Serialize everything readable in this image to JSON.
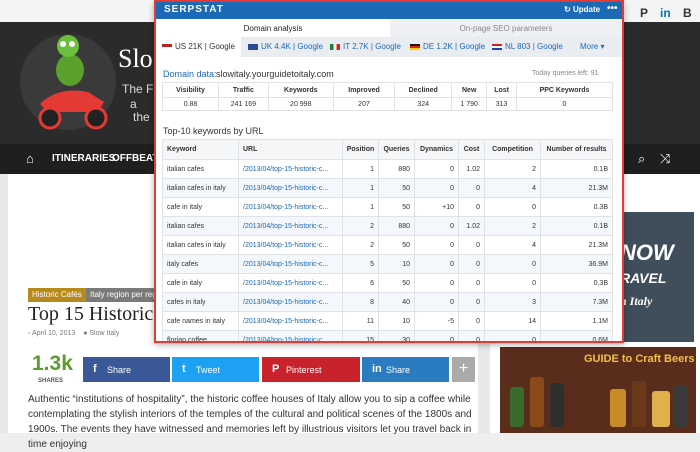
{
  "site": {
    "title": "Slo",
    "tagline_lines": [
      "The Fi",
      "a",
      "the"
    ],
    "social": [
      "P",
      "in",
      "B"
    ],
    "nav": [
      "ITINERARIES",
      "OFFBEAT &"
    ],
    "tags": [
      "Historic Cafés",
      "Italy region per reg"
    ],
    "post_title": "Top 15 Historic",
    "post_date": "April 10, 2013",
    "post_author": "Slow Italy",
    "share_count": "1.3k",
    "share_label": "SHARES",
    "share_buttons": [
      {
        "label": "Share",
        "icon": "f",
        "color": "#3b5998"
      },
      {
        "label": "Tweet",
        "icon": "t",
        "color": "#1da1f2"
      },
      {
        "label": "Pinterest",
        "icon": "P",
        "color": "#c8232c"
      },
      {
        "label": "Share",
        "icon": "in",
        "color": "#2a7bbf"
      }
    ],
    "share_more": "+",
    "body": "Authentic “institutions of hospitality”, the historic coffee houses of Italy allow you to sip a coffee while contemplating the stylish interiors of the temples of the cultural and political scenes of the 1800s and 1900s. The events they have witnessed and memories left by illustrious visitors let you travel back in time enjoying",
    "ad_lines": [
      "NOW",
      "RAVEL",
      "n Italy"
    ],
    "beer_title": "GUIDE to Craft Beers"
  },
  "serpstat": {
    "brand": "SERPSTAT",
    "update_label": "Update",
    "more_dots": "•••",
    "tabs": [
      "Domain analysis",
      "On-page SEO parameters"
    ],
    "databases": [
      {
        "label": "US 21K | Google",
        "flag": "us"
      },
      {
        "label": "UK 4.4K | Google",
        "flag": "uk"
      },
      {
        "label": "IT 2.7K | Google",
        "flag": "it"
      },
      {
        "label": "DE 1.2K | Google",
        "flag": "de"
      },
      {
        "label": "NL 803 | Google",
        "flag": "nl"
      }
    ],
    "more_label": "More ▾",
    "domain_label": "Domain data:",
    "domain": "slowitaly.yourguidetoitaly.com",
    "queries_left": "Today queries left: 91",
    "summary_headers": [
      "Visibility",
      "Traffic",
      "Keywords",
      "Improved",
      "Declined",
      "New",
      "Lost",
      "PPC Keywords"
    ],
    "summary_values": [
      "0.88",
      "241 169",
      "20 998",
      "207",
      "324",
      "1 790",
      "313",
      "0"
    ],
    "keywords_title": "Top-10 keywords by URL",
    "keyword_headers": [
      "Keyword",
      "URL",
      "Position",
      "Queries",
      "Dynamics",
      "Cost",
      "Competition",
      "Number of results"
    ],
    "keywords": [
      [
        "italian cafes",
        "/2013/04/top-15-historic-c...",
        "1",
        "880",
        "0",
        "1.02",
        "2",
        "0.1B"
      ],
      [
        "italian cafes in italy",
        "/2013/04/top-15-historic-c...",
        "1",
        "50",
        "0",
        "0",
        "4",
        "21.3M"
      ],
      [
        "cafe in italy",
        "/2013/04/top-15-historic-c...",
        "1",
        "50",
        "+10",
        "0",
        "0",
        "0.3B"
      ],
      [
        "italian cafes",
        "/2013/04/top-15-historic-c...",
        "2",
        "880",
        "0",
        "1.02",
        "2",
        "0.1B"
      ],
      [
        "italian cafes in italy",
        "/2013/04/top-15-historic-c...",
        "2",
        "50",
        "0",
        "0",
        "4",
        "21.3M"
      ],
      [
        "italy cafes",
        "/2013/04/top-15-historic-c...",
        "5",
        "10",
        "0",
        "0",
        "0",
        "36.9M"
      ],
      [
        "cafe in italy",
        "/2013/04/top-15-historic-c...",
        "6",
        "50",
        "0",
        "0",
        "0",
        "0.3B"
      ],
      [
        "cafes in italy",
        "/2013/04/top-15-historic-c...",
        "8",
        "40",
        "0",
        "0",
        "3",
        "7.3M"
      ],
      [
        "cafe names in italy",
        "/2013/04/top-15-historic-c...",
        "11",
        "10",
        "-5",
        "0",
        "14",
        "1.1M"
      ],
      [
        "florian coffee",
        "/2013/04/top-15-historic-c...",
        "15",
        "30",
        "0",
        "0",
        "0",
        "0.6M"
      ]
    ]
  }
}
